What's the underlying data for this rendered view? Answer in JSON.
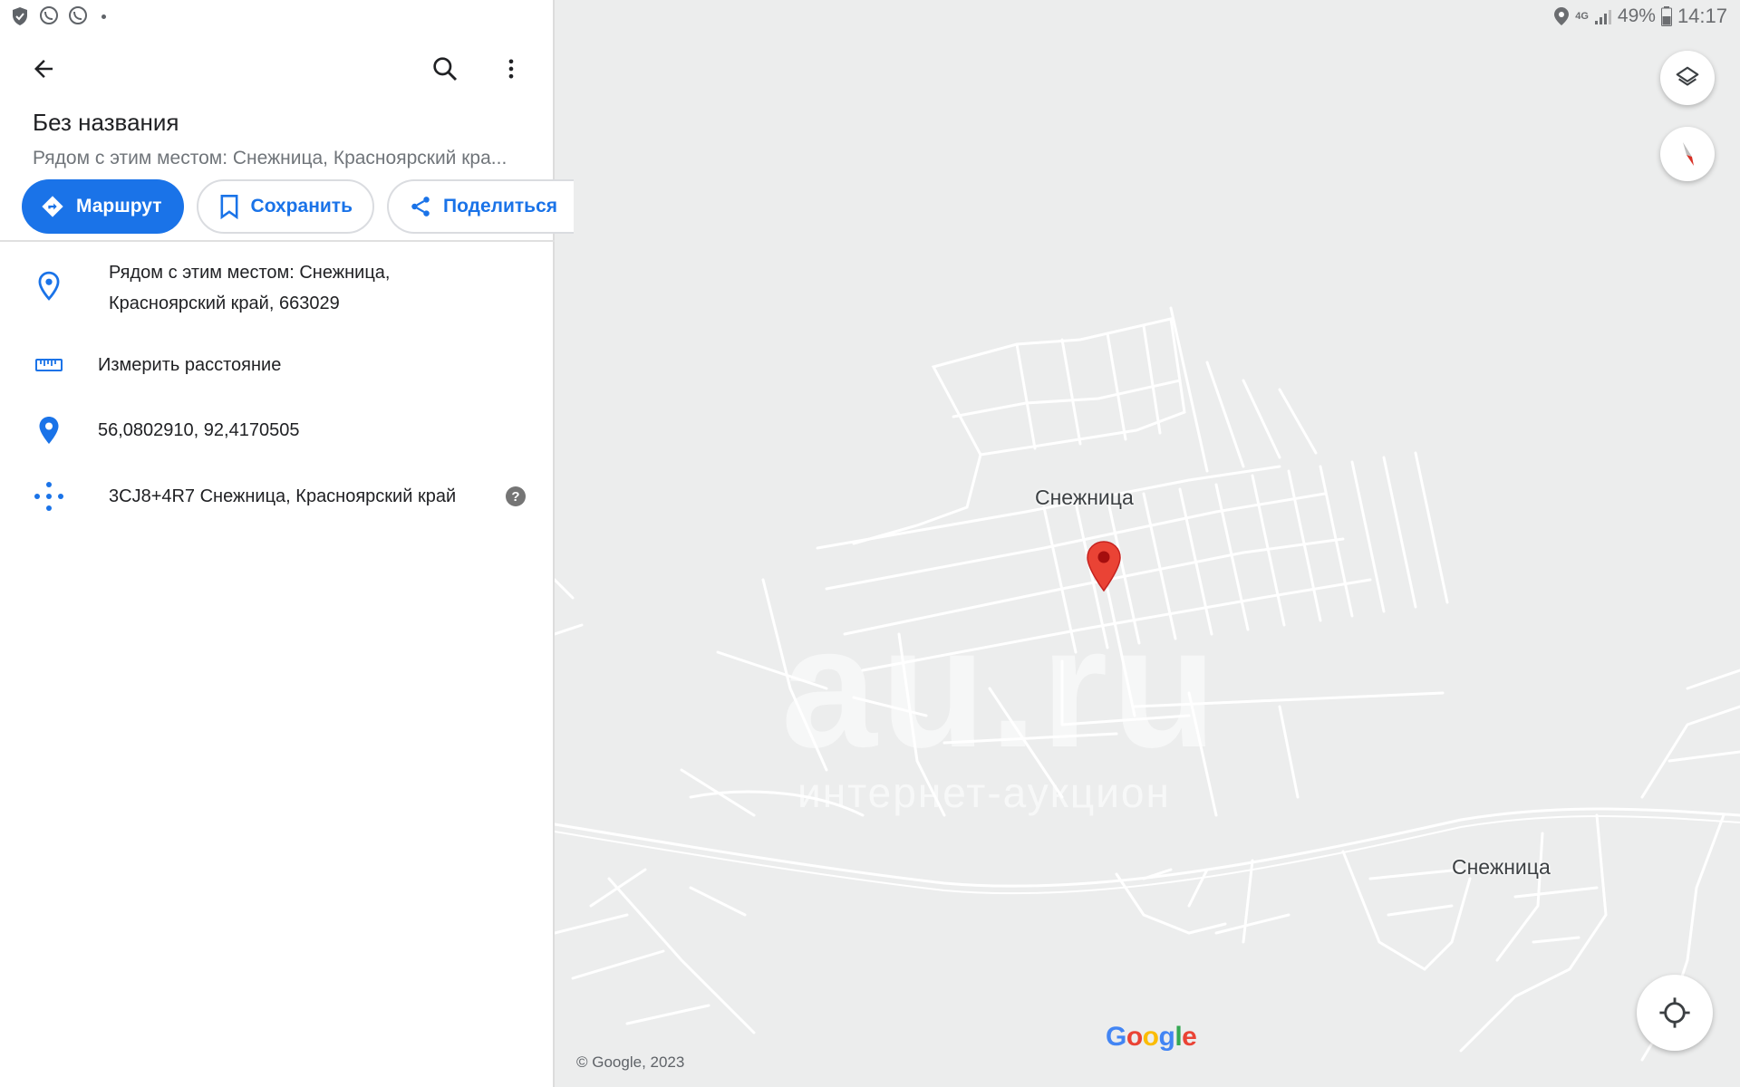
{
  "status_bar": {
    "battery": "49%",
    "time": "14:17",
    "network": "4G"
  },
  "header": {
    "back_icon": "arrow-back-icon",
    "search_icon": "search-icon",
    "more_icon": "more-vert-icon"
  },
  "place": {
    "title": "Без названия",
    "subtitle": "Рядом с этим местом: Снежница, Красноярский кра..."
  },
  "actions": {
    "route_label": "Маршрут",
    "save_label": "Сохранить",
    "share_label": "Поделиться"
  },
  "details": {
    "address_line1": "Рядом с этим местом: Снежница,",
    "address_line2": "Красноярский край, 663029",
    "measure_label": "Измерить расстояние",
    "coordinates": "56,0802910, 92,4170505",
    "plus_code": "3CJ8+4R7 Снежница, Красноярский край",
    "help_glyph": "?"
  },
  "map": {
    "labels": {
      "town_main": "Снежница",
      "town_east": "Снежница"
    },
    "watermark": "au.ru",
    "watermark_sub": "интернет-аукцион",
    "google_logo": "Google",
    "copyright": "© Google, 2023",
    "colors": {
      "background": "#eceded",
      "roads": "#ffffff",
      "pin": "#ea4335",
      "accent": "#1a73e8"
    }
  }
}
